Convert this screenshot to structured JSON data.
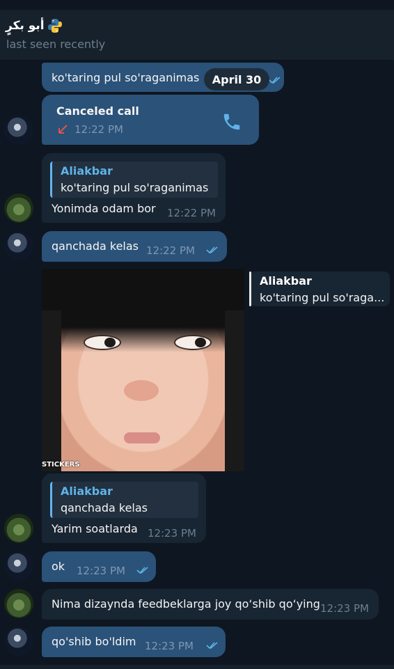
{
  "header": {
    "title": "أبو بكرٍ",
    "subtitle": "last seen recently"
  },
  "date_chip": "April 30",
  "colors": {
    "background": "#0e1621",
    "header_bg": "#17212b",
    "outgoing_bubble": "#2b5278",
    "incoming_bubble": "#182533",
    "reply_name": "#5fb3e8",
    "missed_call_arrow": "#e0534e",
    "call_icon": "#5fb3e8"
  },
  "messages": [
    {
      "text": "ko'taring pul so'raganimas",
      "time": "",
      "direction": "outgoing"
    },
    {
      "call_label": "Canceled call",
      "time": "12:22 PM",
      "icon": "phone-icon",
      "direction": "outgoing"
    },
    {
      "reply_name": "Aliakbar",
      "reply_text": "ko'taring pul so'raganimas",
      "text": "Yonimda odam bor",
      "time": "12:22 PM",
      "direction": "incoming"
    },
    {
      "text": "qanchada kelas",
      "time": "12:22 PM",
      "direction": "outgoing",
      "read": true
    },
    {
      "sticker_label": "STICKERS",
      "reply_name": "Aliakbar",
      "reply_text": "ko'taring pul so'raga...",
      "direction": "outgoing"
    },
    {
      "reply_name": "Aliakbar",
      "reply_text": "qanchada kelas",
      "text": "Yarim soatlarda",
      "time": "12:23 PM",
      "direction": "incoming"
    },
    {
      "text": "ok",
      "time": "12:23 PM",
      "direction": "outgoing",
      "read": true
    },
    {
      "text": "Nima dizaynda feedbeklarga joy qo‘shib qo‘ying",
      "time": "12:23 PM",
      "direction": "incoming"
    },
    {
      "text": "qo'shib bo'ldim",
      "time": "12:23 PM",
      "direction": "outgoing",
      "read": true
    }
  ]
}
